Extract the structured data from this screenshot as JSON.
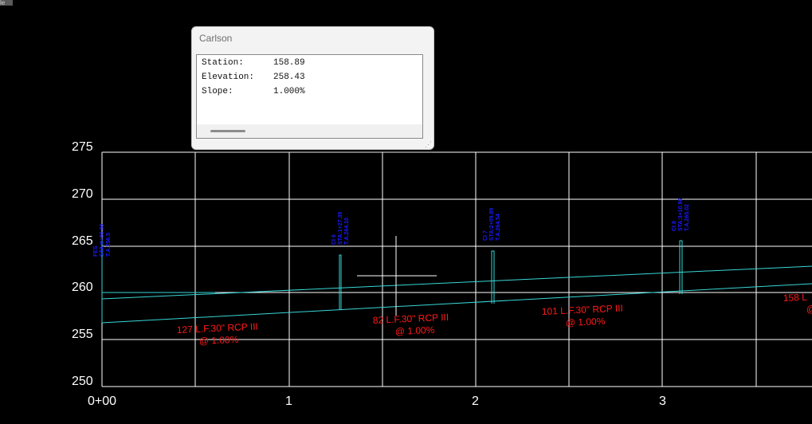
{
  "corner_tab": {
    "label": "le"
  },
  "dialog": {
    "title": "Carlson",
    "rows": [
      {
        "label": "Station:",
        "value": "158.89"
      },
      {
        "label": "Elevation:",
        "value": "258.43"
      },
      {
        "label": "Slope:",
        "value": "1.000%"
      }
    ]
  },
  "profile": {
    "y_ticks": [
      "275",
      "270",
      "265",
      "260",
      "255",
      "250"
    ],
    "x_ticks": [
      "0+00",
      "1",
      "2",
      "3"
    ],
    "pipe_labels": [
      {
        "line1": "127 L.F.30\" RCP III",
        "line2": "@ 1.00%"
      },
      {
        "line1": "82 L.F.30\" RCP III",
        "line2": "@ 1.00%"
      },
      {
        "line1": "101 L.F.30\" RCP III",
        "line2": "@ 1.00%"
      },
      {
        "line1": "158 L",
        "line2": "@"
      }
    ],
    "structure_labels": [
      {
        "line1": "FES",
        "line2": "STA:0+00.00",
        "line3": "T.A.256.5"
      },
      {
        "line1": "CI 6",
        "line2": "STA:1+27.39",
        "line3": "T.A.264.10"
      },
      {
        "line1": "CI 7",
        "line2": "STA:2+09.89",
        "line3": "T.A.264.54"
      },
      {
        "line1": "CI 8",
        "line2": "STA:3+10.96",
        "line3": "T.A.265.02"
      }
    ],
    "colors": {
      "grid": "#ffffff",
      "pipe": "#39d6d6",
      "pipe_text": "#ff1a1a",
      "structure_text": "#1a1aff",
      "background": "#000000"
    }
  }
}
